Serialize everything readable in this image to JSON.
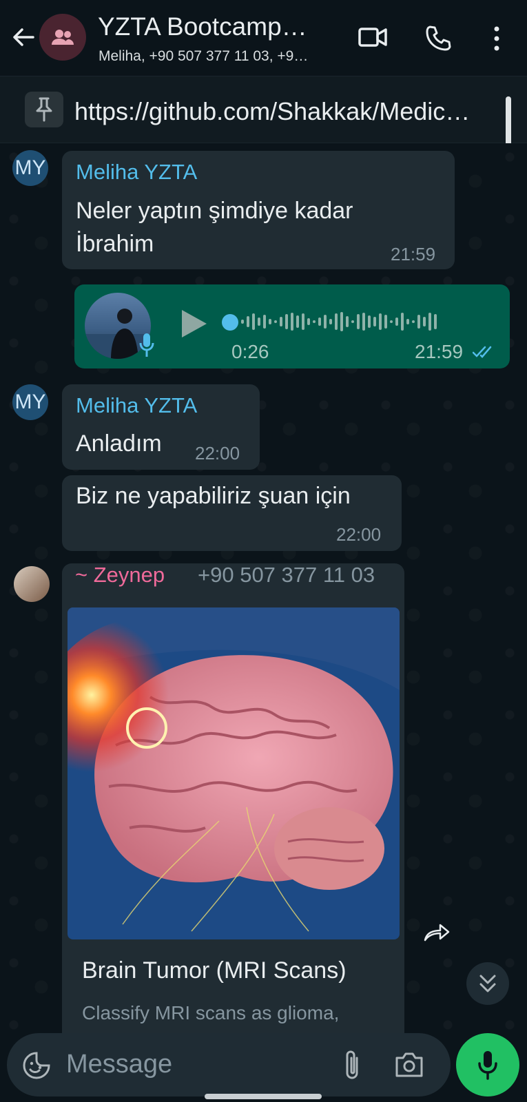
{
  "header": {
    "title": "YZTA Bootcamp…",
    "subtitle": "Meliha, +90 507 377 11 03, +9…"
  },
  "pinned": {
    "text": "https://github.com/Shakkak/Medic…"
  },
  "messages": {
    "m1": {
      "avatar": "MY",
      "sender": "Meliha YZTA",
      "line1": "Neler yaptın şimdiye kadar",
      "line2": "İbrahim",
      "time": "21:59"
    },
    "voice": {
      "duration": "0:26",
      "time": "21:59",
      "status_icon": "double-check-icon"
    },
    "m2": {
      "avatar": "MY",
      "sender": "Meliha YZTA",
      "text": "Anladım",
      "time": "22:00"
    },
    "m3": {
      "text": "Biz ne yapabiliriz şuan için",
      "time": "22:00"
    },
    "m4": {
      "sender": "~ Zeynep",
      "phone": "+90 507 377 11 03",
      "card_title": "Brain Tumor (MRI Scans)",
      "card_desc": "Classify MRI scans as glioma,"
    }
  },
  "composer": {
    "placeholder": "Message"
  },
  "colors": {
    "accent": "#21c063",
    "sender_blue": "#53bdeb",
    "sender_pink": "#ef6a9a",
    "outgoing": "#005c4b"
  }
}
